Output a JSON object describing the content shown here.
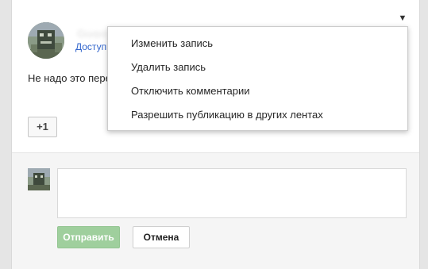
{
  "post": {
    "author_name": "Gugo",
    "audience_label": "Доступно всем",
    "text": "Не надо это переводить",
    "plus_one_label": "+1"
  },
  "menu": {
    "toggle_icon": "chevron-down-icon",
    "items": [
      {
        "label": "Изменить запись"
      },
      {
        "label": "Удалить запись"
      },
      {
        "label": "Отключить комментарии"
      },
      {
        "label": "Разрешить публикацию в других лентах"
      }
    ]
  },
  "comment": {
    "input_value": "",
    "send_label": "Отправить",
    "cancel_label": "Отмена"
  },
  "colors": {
    "link": "#3366cc",
    "send_button_bg": "#9fcf9d",
    "page_bg": "#e5e5e5"
  }
}
